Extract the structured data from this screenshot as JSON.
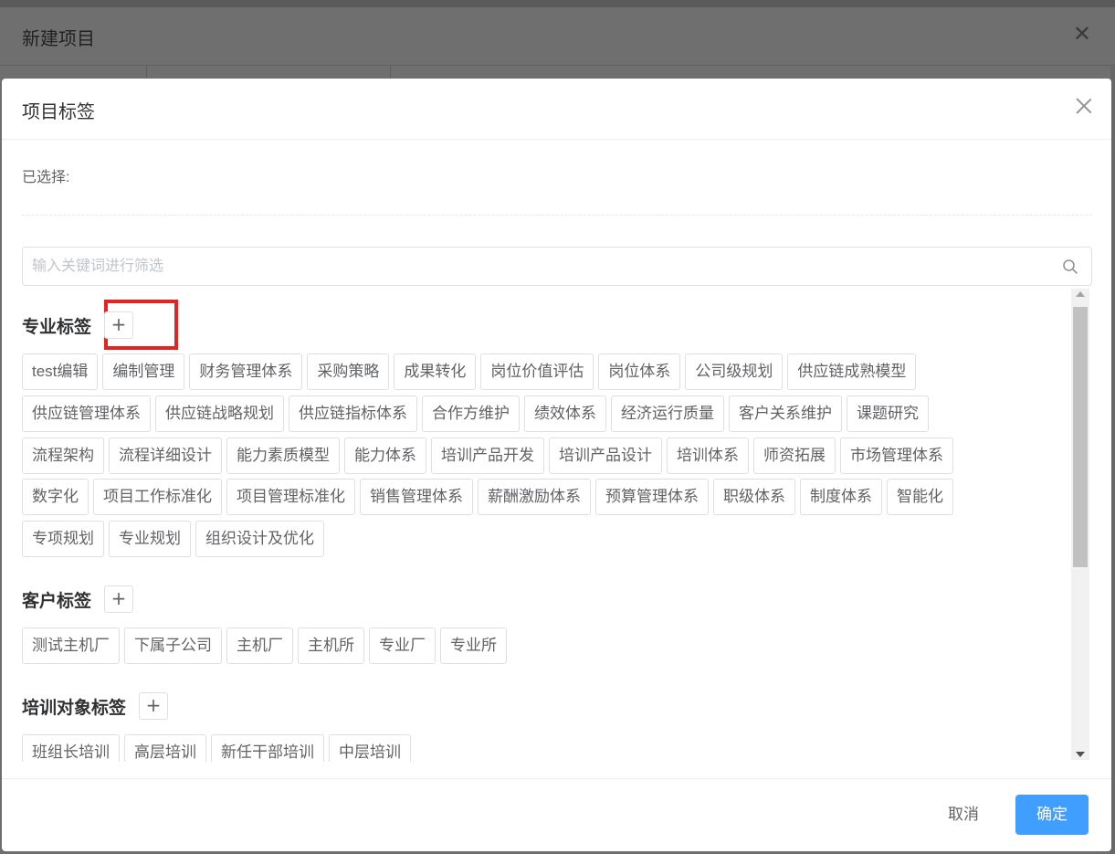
{
  "background_dialog": {
    "title": "新建项目"
  },
  "modal": {
    "title": "项目标签",
    "selected_label": "已选择:",
    "search": {
      "placeholder": "输入关键词进行筛选",
      "value": ""
    },
    "sections": [
      {
        "title": "专业标签",
        "add_label": "+",
        "rows": [
          [
            "test编辑",
            "编制管理",
            "财务管理体系",
            "采购策略",
            "成果转化",
            "岗位价值评估",
            "岗位体系",
            "公司级规划",
            "供应链成熟模型"
          ],
          [
            "供应链管理体系",
            "供应链战略规划",
            "供应链指标体系",
            "合作方维护",
            "绩效体系",
            "经济运行质量",
            "客户关系维护",
            "课题研究"
          ],
          [
            "流程架构",
            "流程详细设计",
            "能力素质模型",
            "能力体系",
            "培训产品开发",
            "培训产品设计",
            "培训体系",
            "师资拓展",
            "市场管理体系"
          ],
          [
            "数字化",
            "项目工作标准化",
            "项目管理标准化",
            "销售管理体系",
            "薪酬激励体系",
            "预算管理体系",
            "职级体系",
            "制度体系",
            "智能化"
          ],
          [
            "专项规划",
            "专业规划",
            "组织设计及优化"
          ]
        ]
      },
      {
        "title": "客户标签",
        "add_label": "+",
        "rows": [
          [
            "测试主机厂",
            "下属子公司",
            "主机厂",
            "主机所",
            "专业厂",
            "专业所"
          ]
        ]
      },
      {
        "title": "培训对象标签",
        "add_label": "+",
        "rows": [
          [
            "班组长培训",
            "高层培训",
            "新任干部培训",
            "中层培训"
          ]
        ]
      }
    ],
    "footer": {
      "cancel_label": "取消",
      "confirm_label": "确定"
    }
  },
  "colors": {
    "primary": "#409eff",
    "highlight": "#e32424",
    "overlay": "#6d6d6d"
  }
}
